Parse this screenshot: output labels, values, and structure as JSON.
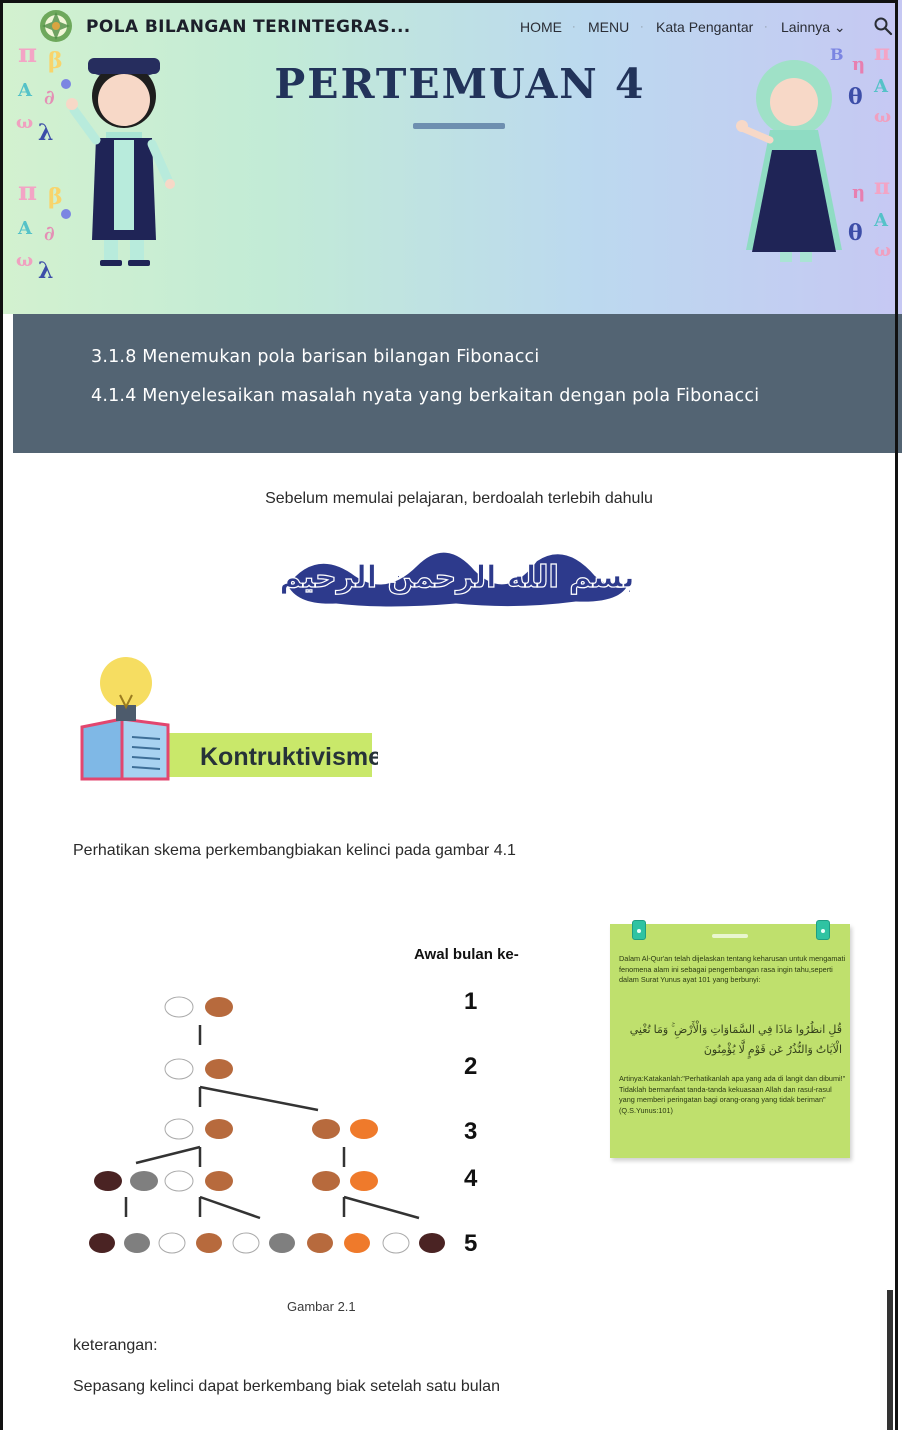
{
  "header": {
    "site_title": "POLA BILANGAN TERINTEGRAS...",
    "nav": [
      {
        "label": "HOME"
      },
      {
        "label": "MENU"
      },
      {
        "label": "Kata Pengantar"
      },
      {
        "label": "Lainnya ⌄"
      }
    ],
    "search_icon": "search-icon"
  },
  "hero": {
    "title": "PERTEMUAN 4"
  },
  "objectives": [
    "3.1.8 Menemukan pola barisan bilangan  Fibonacci",
    "4.1.4 Menyelesaikan masalah nyata yang berkaitan dengan pola Fibonacci"
  ],
  "prayer_text": "Sebelum memulai pelajaran, berdoalah terlebih dahulu",
  "basmala": "بسم الله الرحمن الرحيم",
  "section_heading": "Kontruktivisme",
  "intro_text": "Perhatikan skema perkembangbiakan kelinci pada gambar 4.1",
  "figure": {
    "axis_label": "Awal bulan ke-",
    "months": [
      "1",
      "2",
      "3",
      "4",
      "5"
    ],
    "caption": "Gambar 2.1"
  },
  "note": {
    "text_top": "Dalam Al-Qur'an telah dijelaskan tentang keharusan untuk mengamati fenomena alam ini sebagai pengembangan rasa ingin tahu,seperti dalam Surat Yunus ayat 101 yang berbunyi:",
    "arabic": "قُلِ انظُرُوا مَاذَا فِي السَّمَاوَاتِ وَالْأَرْضِ ۚ وَمَا تُغْنِي الْآيَاتُ وَالنُّذُرُ عَن قَوْمٍ لَّا يُؤْمِنُونَ",
    "text_bottom": "Artinya:Katakanlah:\"Perhatikanlah apa yang ada di langit dan dibumi!\" Tidaklah bermanfaat tanda-tanda kekuasaan Allah dan rasul-rasul yang memberi peringatan bagi orang-orang yang tidak beriman\" (Q.S.Yunus:101)"
  },
  "keterangan_label": "keterangan:",
  "keterangan_text": "Sepasang kelinci dapat berkembang biak setelah satu bulan",
  "colors": {
    "objectives_bg": "#536473",
    "title_color": "#22335a",
    "note_bg": "#bfe06d",
    "heading_banner": "#c9e86a"
  }
}
